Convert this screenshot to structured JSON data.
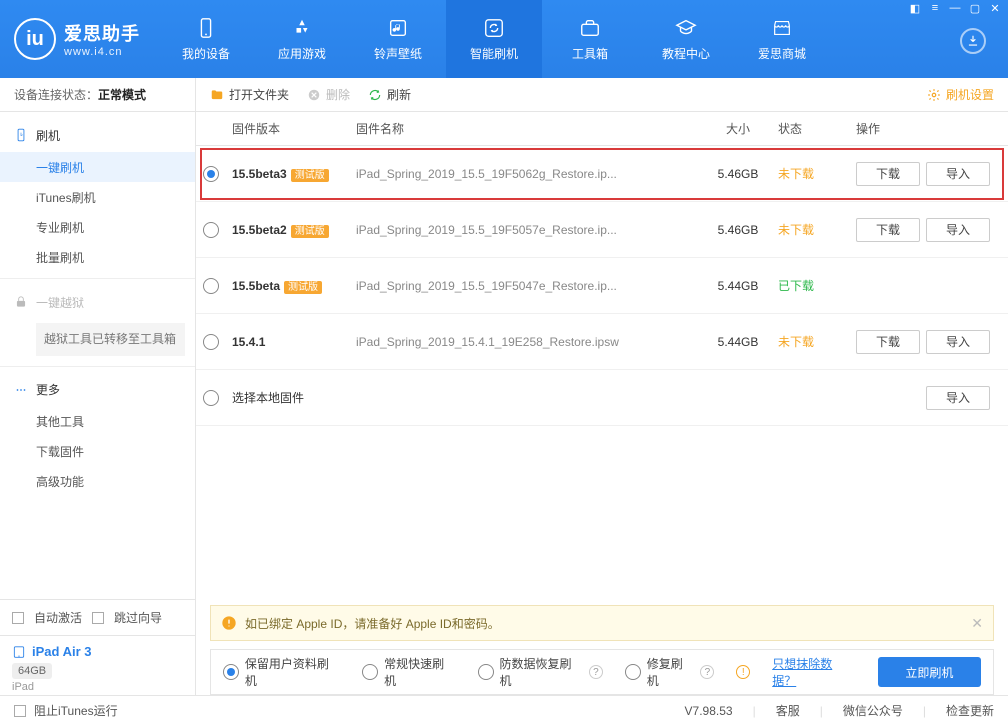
{
  "brand": {
    "name": "爱思助手",
    "url": "www.i4.cn",
    "badge": "iu"
  },
  "nav": [
    {
      "label": "我的设备"
    },
    {
      "label": "应用游戏"
    },
    {
      "label": "铃声壁纸"
    },
    {
      "label": "智能刷机"
    },
    {
      "label": "工具箱"
    },
    {
      "label": "教程中心"
    },
    {
      "label": "爱思商城"
    }
  ],
  "connection": {
    "label": "设备连接状态：",
    "status": "正常模式"
  },
  "sidebar": {
    "flash_head": "刷机",
    "flash_items": [
      "一键刷机",
      "iTunes刷机",
      "专业刷机",
      "批量刷机"
    ],
    "jailbreak_head": "一键越狱",
    "jailbreak_note": "越狱工具已转移至工具箱",
    "more_head": "更多",
    "more_items": [
      "其他工具",
      "下载固件",
      "高级功能"
    ]
  },
  "auto_activate": "自动激活",
  "skip_guide": "跳过向导",
  "device": {
    "name": "iPad Air 3",
    "capacity": "64GB",
    "type": "iPad"
  },
  "toolbar": {
    "open": "打开文件夹",
    "delete": "删除",
    "refresh": "刷新",
    "settings": "刷机设置"
  },
  "columns": {
    "version": "固件版本",
    "name": "固件名称",
    "size": "大小",
    "status": "状态",
    "ops": "操作"
  },
  "beta_tag": "测试版",
  "btn_download": "下载",
  "btn_import": "导入",
  "status_no": "未下载",
  "status_yes": "已下载",
  "rows": [
    {
      "version": "15.5beta3",
      "beta": true,
      "name": "iPad_Spring_2019_15.5_19F5062g_Restore.ip...",
      "size": "5.46GB",
      "downloaded": false,
      "selected": true,
      "buttons": [
        "download",
        "import"
      ]
    },
    {
      "version": "15.5beta2",
      "beta": true,
      "name": "iPad_Spring_2019_15.5_19F5057e_Restore.ip...",
      "size": "5.46GB",
      "downloaded": false,
      "selected": false,
      "buttons": [
        "download",
        "import"
      ]
    },
    {
      "version": "15.5beta",
      "beta": true,
      "name": "iPad_Spring_2019_15.5_19F5047e_Restore.ip...",
      "size": "5.44GB",
      "downloaded": true,
      "selected": false,
      "buttons": []
    },
    {
      "version": "15.4.1",
      "beta": false,
      "name": "iPad_Spring_2019_15.4.1_19E258_Restore.ipsw",
      "size": "5.44GB",
      "downloaded": false,
      "selected": false,
      "buttons": [
        "download",
        "import"
      ]
    }
  ],
  "local_row": "选择本地固件",
  "banner": "如已绑定 Apple ID，请准备好 Apple ID和密码。",
  "modes": {
    "m1": "保留用户资料刷机",
    "m2": "常规快速刷机",
    "m3": "防数据恢复刷机",
    "m4": "修复刷机",
    "link": "只想抹除数据？",
    "go": "立即刷机"
  },
  "statusbar": {
    "block_itunes": "阻止iTunes运行",
    "version": "V7.98.53",
    "support": "客服",
    "wechat": "微信公众号",
    "update": "检查更新"
  }
}
